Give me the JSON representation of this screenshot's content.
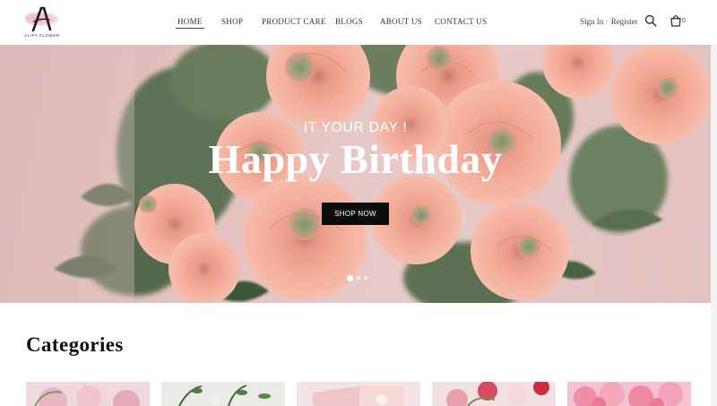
{
  "header": {
    "logo_text": "ALIFA FLOWER",
    "nav": [
      {
        "label": "HOME",
        "active": true
      },
      {
        "label": "SHOP",
        "active": false
      },
      {
        "label": "PRODUCT CARE",
        "active": false
      },
      {
        "label": "BLOGS",
        "active": false
      },
      {
        "label": "ABOUT US",
        "active": false
      },
      {
        "label": "CONTACT US",
        "active": false
      }
    ],
    "auth": {
      "sign_in": "Sign In",
      "separator": "/",
      "register": "Register"
    },
    "cart_count": "0",
    "icons": [
      "search-icon",
      "shopping-bag-icon"
    ]
  },
  "hero": {
    "subtitle": "IT YOUR DAY !",
    "title": "Happy Birthday",
    "button_label": "SHOP NOW",
    "slides": 3,
    "active_slide": 1
  },
  "categories": {
    "title": "Categories",
    "tiles": 5
  },
  "colors": {
    "button_bg": "#0c0c0c",
    "hero_text": "#ffffff",
    "rose": "#f1a592",
    "logo_pink": "#f2b3c4"
  }
}
